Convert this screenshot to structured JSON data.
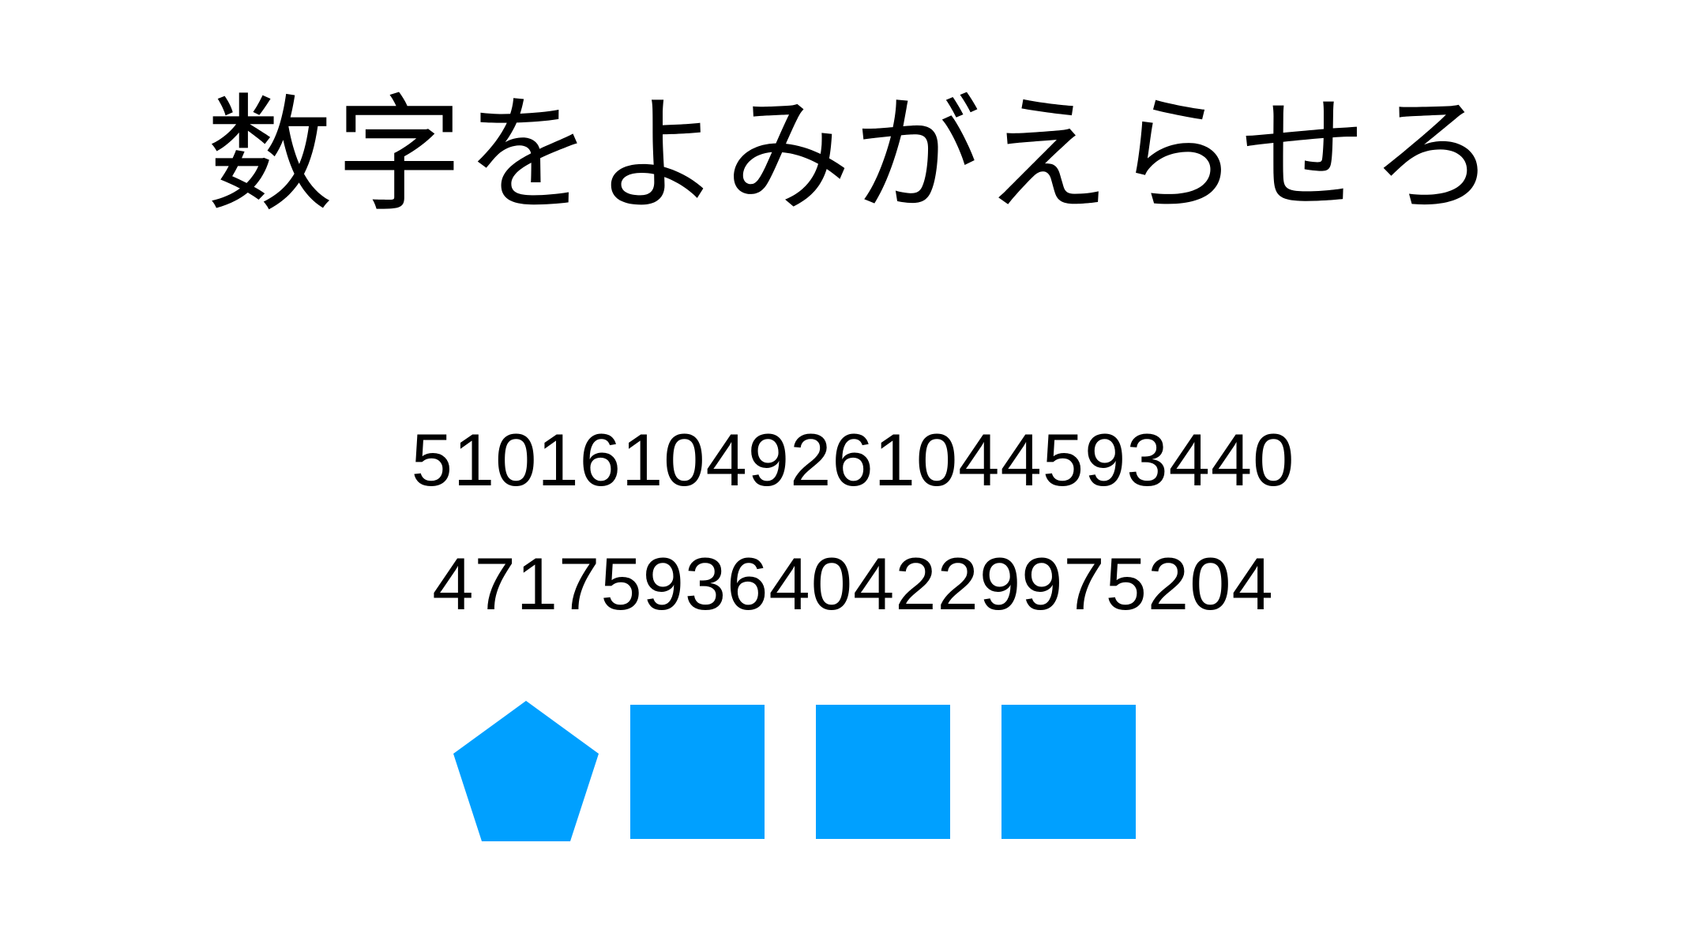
{
  "title": "数字をよみがえらせろ",
  "digit_lines": [
    "5101610492610445934 40",
    "47175936404229975204"
  ],
  "shapes": {
    "color": "#00a0ff",
    "items": [
      "pentagon-icon",
      "square-icon",
      "square-icon",
      "square-icon"
    ]
  }
}
